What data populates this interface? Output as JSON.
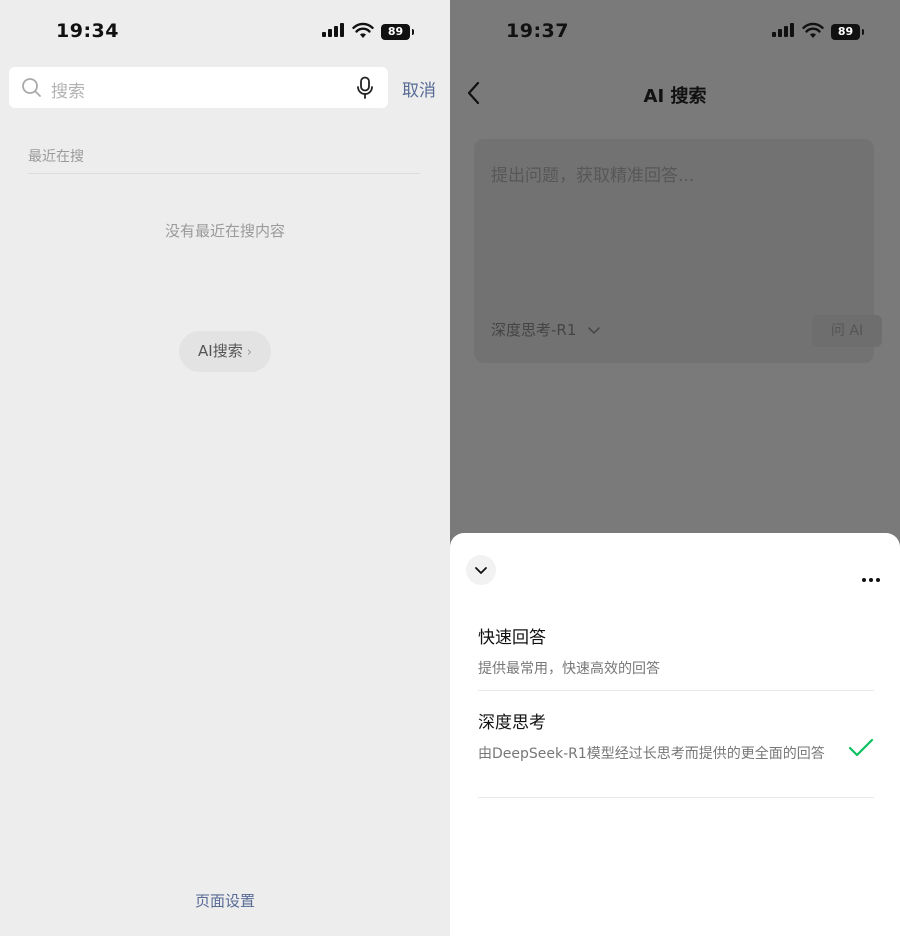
{
  "left": {
    "status": {
      "time": "19:34",
      "battery": "89"
    },
    "search": {
      "placeholder": "搜索",
      "cancel": "取消"
    },
    "recent_label": "最近在搜",
    "empty_text": "没有最近在搜内容",
    "ai_search_button": "AI搜索",
    "page_settings": "页面设置"
  },
  "right": {
    "status": {
      "time": "19:37",
      "battery": "89"
    },
    "title": "AI 搜索",
    "input_placeholder": "提出问题，获取精准回答...",
    "model_selected": "深度思考-R1",
    "ask_button": "问 AI",
    "sheet": {
      "options": [
        {
          "title": "快速回答",
          "desc": "提供最常用，快速高效的回答",
          "selected": false
        },
        {
          "title": "深度思考",
          "desc": "由DeepSeek-R1模型经过长思考而提供的更全面的回答",
          "selected": true
        }
      ]
    }
  },
  "colors": {
    "accent_link": "#576b95",
    "check": "#07c160",
    "overlay": "#7a7a7a"
  }
}
